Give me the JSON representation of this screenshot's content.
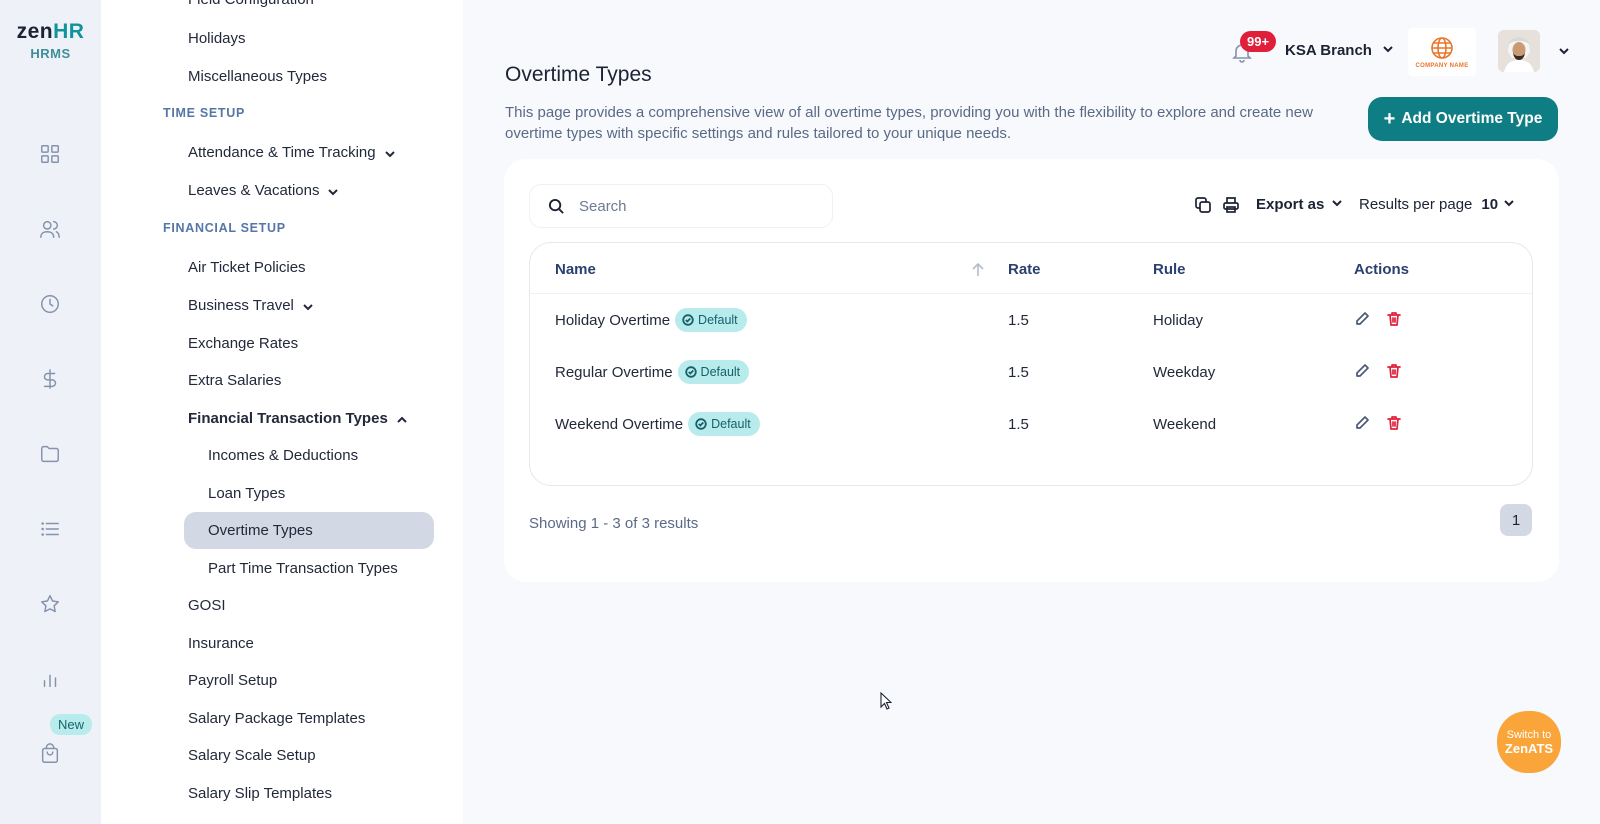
{
  "brand": {
    "logo_zen": "zen",
    "logo_hr": "HR",
    "subtitle": "HRMS"
  },
  "rail": {
    "icons": [
      "dashboard-icon",
      "people-icon",
      "clock-icon",
      "dollar-icon",
      "folder-icon",
      "list-icon",
      "star-icon",
      "bar-chart-icon",
      "shopping-bag-icon"
    ],
    "new_badge": "New"
  },
  "menu": {
    "items": [
      {
        "label": "Field Configuration"
      },
      {
        "label": "Holidays"
      },
      {
        "label": "Miscellaneous Types"
      }
    ],
    "time_setup": {
      "title": "TIME SETUP",
      "items": [
        {
          "label": "Attendance & Time Tracking"
        },
        {
          "label": "Leaves & Vacations"
        }
      ]
    },
    "financial_setup": {
      "title": "FINANCIAL SETUP",
      "items": [
        {
          "label": "Air Ticket Policies"
        },
        {
          "label": "Business Travel"
        },
        {
          "label": "Exchange Rates"
        },
        {
          "label": "Extra Salaries"
        },
        {
          "label": "Financial Transaction Types"
        },
        {
          "label": "Incomes & Deductions"
        },
        {
          "label": "Loan Types"
        },
        {
          "label": "Overtime Types"
        },
        {
          "label": "Part Time Transaction Types"
        },
        {
          "label": "GOSI"
        },
        {
          "label": "Insurance"
        },
        {
          "label": "Payroll Setup"
        },
        {
          "label": "Salary Package Templates"
        },
        {
          "label": "Salary Scale Setup"
        },
        {
          "label": "Salary Slip Templates"
        }
      ]
    }
  },
  "header": {
    "notification_count": "99+",
    "branch": "KSA Branch",
    "company_logo_text": "COMPANY NAME"
  },
  "page": {
    "title": "Overtime Types",
    "description": "This page provides a comprehensive view of all overtime types, providing you with the flexibility to explore and create new overtime types with specific settings and rules tailored to your unique needs.",
    "add_button": "Add Overtime Type"
  },
  "toolbar": {
    "search_placeholder": "Search",
    "export_label": "Export as",
    "results_per_page_label": "Results per page",
    "results_per_page_value": "10"
  },
  "table": {
    "columns": [
      "Name",
      "Rate",
      "Rule",
      "Actions"
    ],
    "rows": [
      {
        "name": "Holiday Overtime",
        "badge": "Default",
        "rate": "1.5",
        "rule": "Holiday"
      },
      {
        "name": "Regular Overtime",
        "badge": "Default",
        "rate": "1.5",
        "rule": "Weekday"
      },
      {
        "name": "Weekend Overtime",
        "badge": "Default",
        "rate": "1.5",
        "rule": "Weekend"
      }
    ]
  },
  "pagination": {
    "showing_text": "Showing 1 - 3 of 3 results",
    "current_page": "1"
  },
  "switch_widget": {
    "line1": "Switch to",
    "line2": "ZenATS"
  },
  "colors": {
    "primary": "#0f7d84",
    "badge_bg": "#b8ecec",
    "danger": "#e0203b",
    "accent_orange": "#f9a53a",
    "active_menu_bg": "#d2d9e5"
  }
}
